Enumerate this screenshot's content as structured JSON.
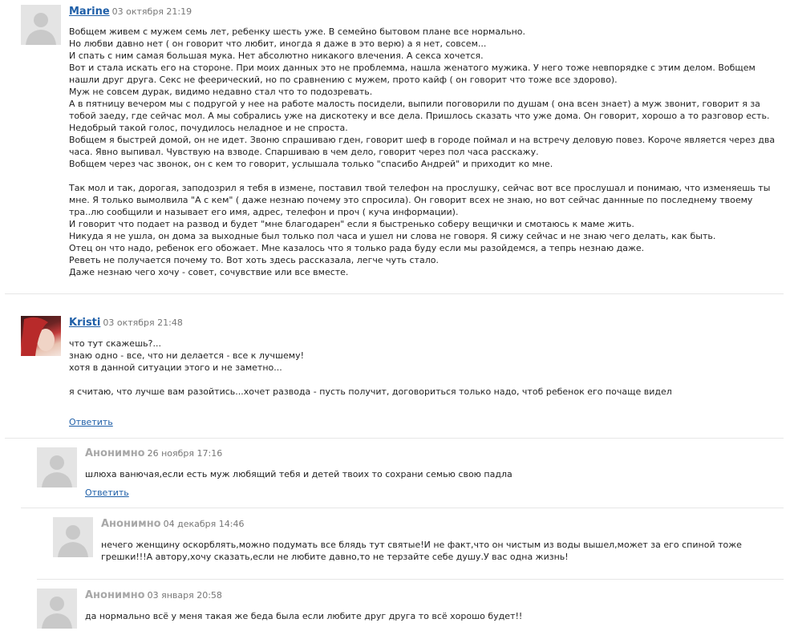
{
  "comments": [
    {
      "author": "Marine",
      "date": "03 октября 21:19",
      "text": "Вобщем живем с мужем семь лет, ребенку шесть уже. В семейно бытовом плане все нормально.\nНо любви давно нет ( он говорит что любит, иногда я даже в это верю) а я нет, совсем...\nИ спать с ним самая большая мука. Нет абсолютно никакого влечения. А секса хочется.\nВот и стала искать его на стороне. При моих данных это не проблемма, нашла женатого мужика. У него тоже невпорядке с этим делом. Вобщем нашли друг друга. Секс не феерический, но по сравнению с мужем, прото кайф ( он говорит что тоже все здорово).\nМуж не совсем дурак, видимо недавно стал что то подозревать.\nА в пятницу вечером мы с подругой у нее на работе малость посидели, выпили поговорили по душам ( она всен знает) а муж звонит, говорит я за тобой заеду, где сейчас мол. А мы собрались уже на дискотеку и все дела. Пришлось сказать что уже дома. Он говорит, хорошо а то разговор есть.\nНедобрый такой голос, почудилось неладное и не спроста.\nВобщем я быстрей домой, он не идет. Звоню спрашиваю гден, говорит шеф в городе поймал и на встречу деловую повез. Короче является через два часа. Явно выпивал. Чувствую на взводе. Спаршиваю в чем дело, говорит через пол часа расскажу.\nВобщем через час звонок, он с кем то говорит, услышала только \"спасибо Андрей\" и приходит ко мне.\n\nТак мол и так, дорогая, заподозрил я тебя в измене, поставил твой телефон на прослушку, сейчас вот все прослушал и понимаю, что изменяешь ты мне. Я только вымолвила \"А с кем\" ( даже незнаю почему это спросила). Он говорит всех не знаю, но вот сейчас даннные по последнему твоему тра..лю сообщили и называет его имя, адрес, телефон и проч ( куча информации).\nИ говорит что подает на развод и будет \"мне благодарен\" если я быстренько соберу вещички и смотаюсь к маме жить.\nНикуда я не ушла, он дома за выходные был только пол часа и ушел ни слова не говоря. Я сижу сейчас и не знаю чего делать, как быть.\nОтец он что надо, ребенок его обожает. Мне казалось что я только рада буду если мы разойдемся, а тепрь незнаю даже.\nРеветь не получается почему то. Вот хоть здесь рассказала, легче чуть стало.\nДаже незнаю чего хочу - совет, сочувствие или все вместе."
    },
    {
      "author": "Kristi",
      "date": "03 октября 21:48",
      "text": "что тут скажешь?...\nзнаю одно - все, что ни делается - все к лучшему!\nхотя в данной ситуации этого и не заметно...\n\nя считаю, что лучше вам разойтись...хочет развода - пусть получит, договориться только надо, чтоб ребенок его почаще видел",
      "reply": "Ответить"
    },
    {
      "author": "Анонимно",
      "date": "26 ноября 17:16",
      "text": "шлюха ванючая,если есть муж любящий тебя и детей твоих то сохрани семью свою падла",
      "reply": "Ответить"
    },
    {
      "author": "Анонимно",
      "date": "04 декабря 14:46",
      "text": "нечего женщину оскорблять,можно подумать все блядь тут святые!И не факт,что он чистым из воды вышел,может за его спиной тоже грешки!!!А автору,хочу сказать,если не любите давно,то не терзайте себе душу.У вас одна жизнь!"
    },
    {
      "author": "Анонимно",
      "date": "03 января 20:58",
      "text": "да нормально всё у меня такая же беда была если любите друг друга то всё хорошо будет!!"
    }
  ]
}
